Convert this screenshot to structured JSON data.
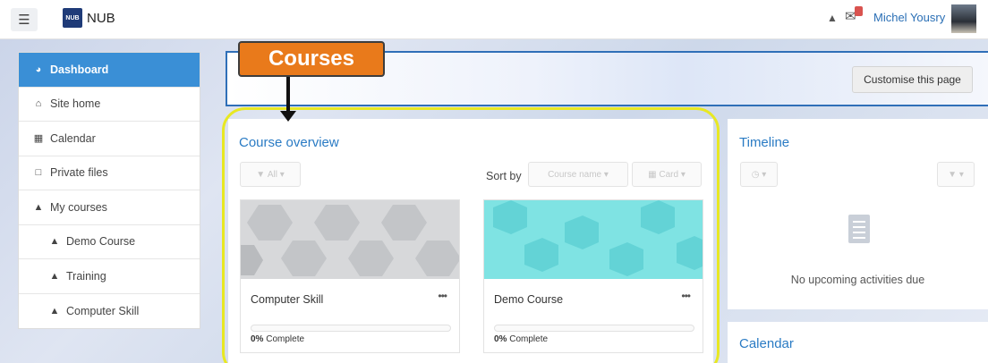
{
  "navbar": {
    "brand": "NUB",
    "logo_text": "NUB",
    "user_name": "Michel Yousry",
    "icons": [
      "menu-icon",
      "bell-icon",
      "message-icon"
    ]
  },
  "nav": {
    "items": [
      {
        "label": "Dashboard",
        "icon": "dashboard-icon"
      },
      {
        "label": "Site home",
        "icon": "home-icon"
      },
      {
        "label": "Calendar",
        "icon": "calendar-icon"
      },
      {
        "label": "Private files",
        "icon": "file-icon"
      },
      {
        "label": "My courses",
        "icon": "graduation-cap-icon"
      },
      {
        "label": "Demo Course",
        "icon": "graduation-cap-icon"
      },
      {
        "label": "Training",
        "icon": "graduation-cap-icon"
      },
      {
        "label": "Computer Skill",
        "icon": "graduation-cap-icon"
      }
    ]
  },
  "header": {
    "customise_label": "Customise this page"
  },
  "annotation": {
    "callout_text": "Courses",
    "accent": "#e97a1b",
    "highlight_color": "#e8e823"
  },
  "course_overview": {
    "title": "Course overview",
    "filter_label": "All",
    "sort_by_label": "Sort by",
    "sort_value": "Course name",
    "view_value": "Card",
    "courses": [
      {
        "name": "Computer Skill",
        "progress_percent": 0,
        "progress_value": "0%",
        "progress_suffix": " Complete",
        "image_color": "#d7d8da"
      },
      {
        "name": "Demo Course",
        "progress_percent": 0,
        "progress_value": "0%",
        "progress_suffix": " Complete",
        "image_color": "#7fe3e3"
      }
    ]
  },
  "timeline": {
    "title": "Timeline",
    "empty_text": "No upcoming activities due"
  },
  "calendar": {
    "title": "Calendar"
  },
  "colors": {
    "primary": "#3a8fd6",
    "link": "#2a7bc4"
  }
}
